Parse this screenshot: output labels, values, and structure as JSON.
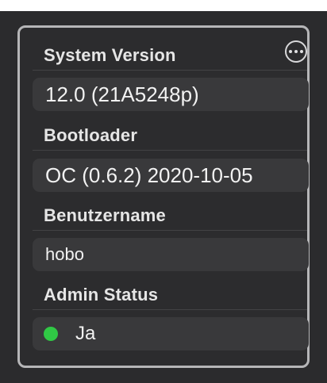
{
  "panel": {
    "more_icon": "ellipsis-circle-icon",
    "sections": {
      "system_version": {
        "label": "System Version",
        "value": "12.0 (21A5248p)"
      },
      "bootloader": {
        "label": "Bootloader",
        "value": "OC (0.6.2) 2020-10-05"
      },
      "username": {
        "label": "Benutzername",
        "value": "hobo"
      },
      "admin_status": {
        "label": "Admin Status",
        "value": "Ja",
        "indicator_color": "#30c845"
      }
    }
  },
  "colors": {
    "background": "#2b2b2d",
    "panel_border": "#b6b6b8",
    "field_background": "#39393b",
    "text": "#f2f2f2"
  }
}
